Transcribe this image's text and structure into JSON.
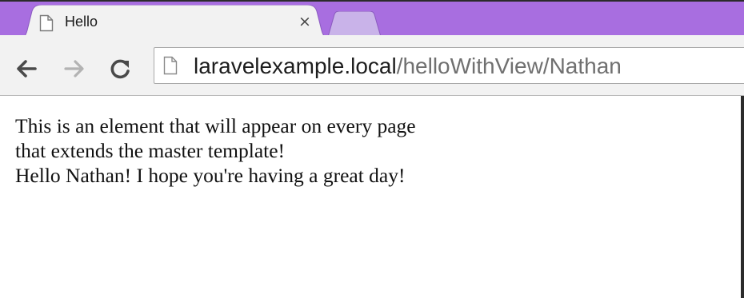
{
  "browser": {
    "tab": {
      "title": "Hello",
      "close_glyph": "×",
      "favicon": "page-icon"
    },
    "new_tab": {
      "icon": "new-tab-icon"
    },
    "toolbar": {
      "back_icon": "back-arrow-icon",
      "forward_icon": "forward-arrow-icon",
      "reload_icon": "reload-icon"
    },
    "address_bar": {
      "icon": "page-icon",
      "host": "laravelexample.local",
      "path": "/helloWithView/Nathan"
    }
  },
  "page": {
    "lines": [
      "This is an element that will appear on every page",
      "that extends the master template!",
      "Hello Nathan! I hope you're having a great day!"
    ]
  },
  "colors": {
    "tab_strip": "#a86ee0",
    "toolbar": "#f2f2f2",
    "page_background": "#ffffff",
    "window_frame": "#2b2b2b"
  }
}
